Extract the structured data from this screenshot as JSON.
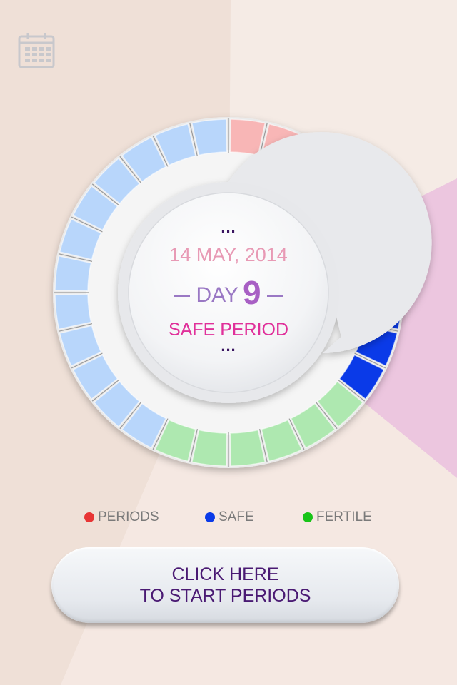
{
  "hub": {
    "top_dots": "...",
    "date": "14 MAY, 2014",
    "day_prefix": "DAY",
    "day_number": "9",
    "status": "SAFE PERIOD",
    "bottom_dots": "..."
  },
  "cycle": {
    "total_segments": 28,
    "phases": [
      {
        "name": "period",
        "segments": 5,
        "color": "#f8b6b6"
      },
      {
        "name": "safe",
        "segments": 5,
        "color": "#0a3ae8"
      },
      {
        "name": "fertile",
        "segments": 6,
        "color": "#aee8b0"
      },
      {
        "name": "safe",
        "segments": 12,
        "color": "#b8d6fb"
      }
    ],
    "current_day": 9
  },
  "legend": [
    {
      "label": "PERIODS",
      "color": "#e83535"
    },
    {
      "label": "SAFE",
      "color": "#0a3ae8"
    },
    {
      "label": "FERTILE",
      "color": "#18c418"
    }
  ],
  "button": {
    "line1": "CLICK HERE",
    "line2": "TO START PERIODS"
  },
  "icons": {
    "calendar": "calendar-icon"
  },
  "colors": {
    "accent_pink": "#e0309a",
    "date_pink": "#e89ab5",
    "day_purple": "#9a78c4",
    "button_text": "#4a1a73"
  }
}
